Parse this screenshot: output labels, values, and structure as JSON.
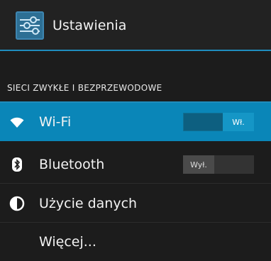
{
  "actionbar": {
    "title": "Ustawienia",
    "icon": "settings-sliders-icon",
    "accent": "#1f8dbd"
  },
  "section": {
    "header": "SIECI ZWYKŁE I BEZPRZEWODOWE"
  },
  "items": [
    {
      "label": "Wi-Fi",
      "icon": "wifi-icon",
      "selected": true,
      "toggle": {
        "label": "Wł.",
        "state": "on"
      }
    },
    {
      "label": "Bluetooth",
      "icon": "bluetooth-icon",
      "selected": false,
      "toggle": {
        "label": "Wył.",
        "state": "off"
      }
    },
    {
      "label": "Użycie danych",
      "icon": "data-usage-icon",
      "selected": false
    },
    {
      "label": "Więcej...",
      "selected": false
    }
  ],
  "colors": {
    "selected_row": "#0a86b8",
    "background": "#1c1c1c"
  }
}
